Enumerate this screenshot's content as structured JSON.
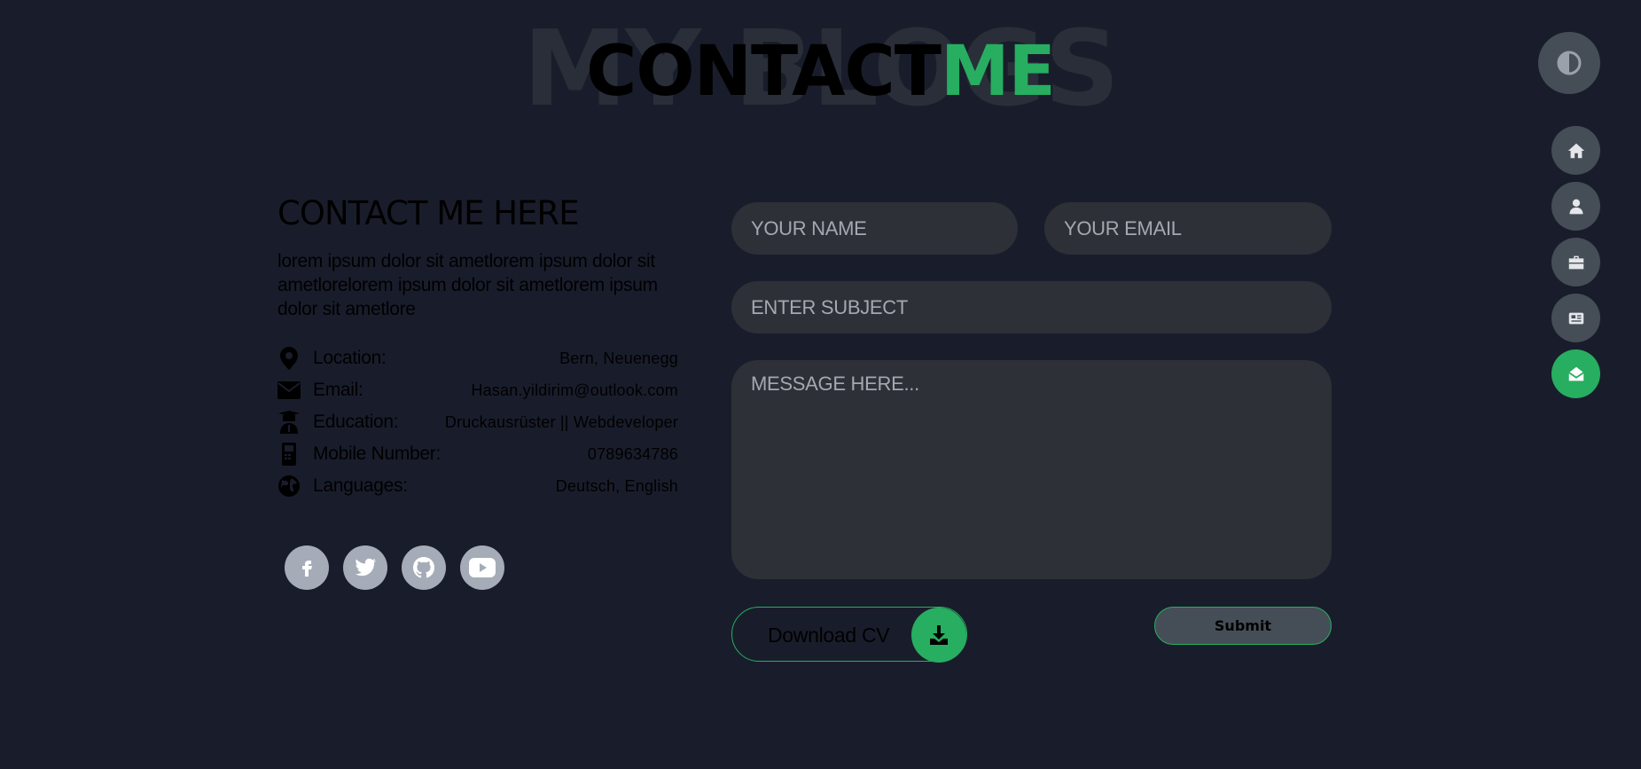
{
  "header": {
    "background_title": "MY BLOGS",
    "title_main": "CONTACT",
    "title_accent": "ME"
  },
  "theme_toggle": {
    "icon": "contrast-icon"
  },
  "nav": {
    "items": [
      {
        "icon": "home-icon",
        "active": false
      },
      {
        "icon": "user-icon",
        "active": false
      },
      {
        "icon": "briefcase-icon",
        "active": false
      },
      {
        "icon": "newspaper-icon",
        "active": false
      },
      {
        "icon": "envelope-open-icon",
        "active": true
      }
    ]
  },
  "contact": {
    "heading": "CONTACT ME HERE",
    "intro": "lorem ipsum dolor sit ametlorem ipsum dolor sit ametlorelorem ipsum dolor sit ametlorem ipsum dolor sit ametlore",
    "info": [
      {
        "icon": "location-pin-icon",
        "label": "Location:",
        "value": "Bern, Neuenegg"
      },
      {
        "icon": "envelope-icon",
        "label": "Email:",
        "value": "Hasan.yildirim@outlook.com"
      },
      {
        "icon": "graduate-icon",
        "label": "Education:",
        "value": "Druckausrüster || Webdeveloper"
      },
      {
        "icon": "mobile-phone-icon",
        "label": "Mobile Number:",
        "value": "0789634786"
      },
      {
        "icon": "globe-icon",
        "label": "Languages:",
        "value": "Deutsch, English"
      }
    ],
    "socials": [
      {
        "icon": "facebook-icon"
      },
      {
        "icon": "twitter-icon"
      },
      {
        "icon": "github-icon"
      },
      {
        "icon": "youtube-icon"
      }
    ]
  },
  "form": {
    "name_placeholder": "YOUR NAME",
    "email_placeholder": "YOUR EMAIL",
    "subject_placeholder": "ENTER SUBJECT",
    "message_placeholder": "MESSAGE HERE...",
    "download_label": "Download CV",
    "submit_label": "Submit"
  },
  "colors": {
    "background": "#191d2b",
    "accent": "#27ae60",
    "button_grey": "#454e56",
    "input_bg": "#2d3037",
    "social_bg": "#a5acb8"
  }
}
